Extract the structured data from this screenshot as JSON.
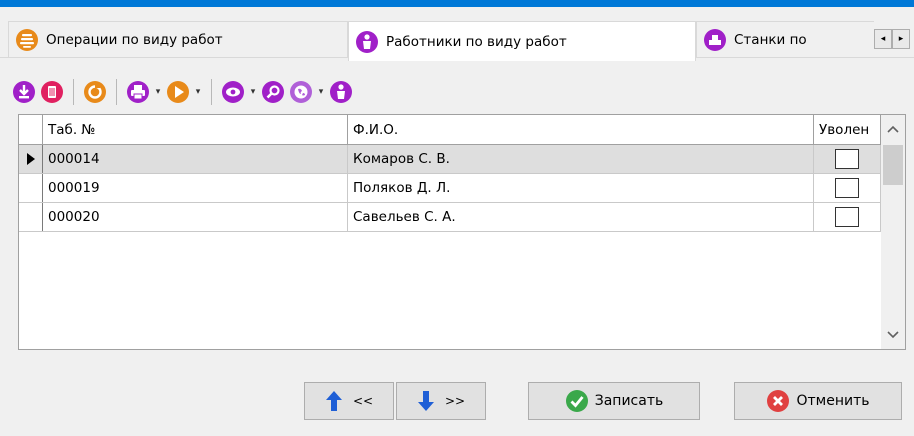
{
  "tabs": [
    {
      "label": "Операции по виду работ",
      "icon": "operations-icon",
      "active": false
    },
    {
      "label": "Работники по виду работ",
      "icon": "worker-icon",
      "active": true
    },
    {
      "label": "Станки по",
      "icon": "machine-icon",
      "active": false
    }
  ],
  "tab_scroll": {
    "left": "◂",
    "right": "▸"
  },
  "toolbar": {
    "icons": [
      "download-icon",
      "delete-icon",
      "refresh-icon",
      "print-icon",
      "play-icon",
      "view-icon",
      "search-icon",
      "globe-icon",
      "worker-icon"
    ],
    "dropdown_glyph": "▾"
  },
  "grid": {
    "columns": [
      "Таб. №",
      "Ф.И.О.",
      "Уволен"
    ],
    "rows": [
      {
        "tab_no": "000014",
        "name": "Комаров С. В.",
        "dismissed": false,
        "selected": true
      },
      {
        "tab_no": "000019",
        "name": "Поляков Д. Л.",
        "dismissed": false,
        "selected": false
      },
      {
        "tab_no": "000020",
        "name": "Савельев С. А.",
        "dismissed": false,
        "selected": false
      }
    ],
    "scroll_up": "^",
    "scroll_down": "v"
  },
  "buttons": {
    "prev_label": "<<",
    "next_label": ">>",
    "save_label": "Записать",
    "cancel_label": "Отменить"
  },
  "colors": {
    "accent": "#0078d7",
    "icon_purple": "#a020c8",
    "icon_orange": "#e88a1a",
    "save_green": "#3aa84a",
    "cancel_red": "#e04040",
    "arrow_blue": "#1f5fd6"
  }
}
